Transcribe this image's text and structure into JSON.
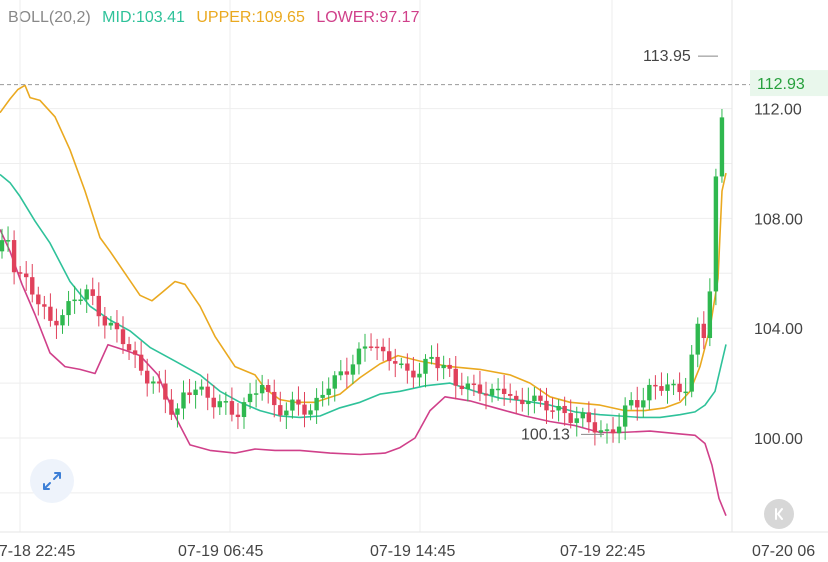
{
  "indicator": {
    "label": "BOLL(20,2)",
    "mid": "MID:103.41",
    "upper": "UPPER:109.65",
    "lower": "LOWER:97.17"
  },
  "colors": {
    "boll_label": "#888888",
    "mid": "#2fc29a",
    "upper": "#eaa920",
    "lower": "#d0408a",
    "up_candle": "#2fb84f",
    "down_candle": "#e0415b",
    "grid": "#eeeeee",
    "text": "#444444",
    "last_price_text": "#27a03d",
    "last_price_bg": "#e9f7ec"
  },
  "chart_data": {
    "type": "candlestick",
    "y_axis_labels": [
      "112.00",
      "108.00",
      "104.00",
      "100.00"
    ],
    "ylim": [
      97,
      115
    ],
    "x_tick_labels": [
      "07-18 22:45",
      "07-19 06:45",
      "07-19 14:45",
      "07-19 22:45",
      "07-20 06"
    ],
    "last_price": "112.93",
    "max_marker": "113.95",
    "min_marker": "100.13",
    "grid": true,
    "boll_upper": [
      [
        0,
        111.85
      ],
      [
        10,
        112.35
      ],
      [
        18,
        112.7
      ],
      [
        25,
        112.85
      ],
      [
        30,
        112.4
      ],
      [
        40,
        112.3
      ],
      [
        55,
        111.7
      ],
      [
        70,
        110.5
      ],
      [
        85,
        109.0
      ],
      [
        100,
        107.3
      ],
      [
        110,
        106.8
      ],
      [
        125,
        106.0
      ],
      [
        140,
        105.2
      ],
      [
        152,
        105.0
      ],
      [
        162,
        105.3
      ],
      [
        175,
        105.7
      ],
      [
        185,
        105.6
      ],
      [
        200,
        104.8
      ],
      [
        215,
        103.7
      ],
      [
        235,
        102.6
      ],
      [
        255,
        102.3
      ],
      [
        265,
        101.8
      ],
      [
        280,
        101.4
      ],
      [
        295,
        101.3
      ],
      [
        315,
        101.3
      ],
      [
        340,
        101.6
      ],
      [
        360,
        102.2
      ],
      [
        380,
        102.7
      ],
      [
        398,
        103.0
      ],
      [
        420,
        102.8
      ],
      [
        450,
        102.6
      ],
      [
        480,
        102.5
      ],
      [
        510,
        102.3
      ],
      [
        530,
        102.0
      ],
      [
        550,
        101.5
      ],
      [
        570,
        101.3
      ],
      [
        600,
        101.2
      ],
      [
        625,
        101.0
      ],
      [
        645,
        101.0
      ],
      [
        665,
        101.1
      ],
      [
        680,
        101.3
      ],
      [
        690,
        101.7
      ],
      [
        700,
        102.6
      ],
      [
        710,
        104.0
      ],
      [
        718,
        105.8
      ],
      [
        722,
        109.0
      ],
      [
        726,
        109.65
      ]
    ],
    "boll_mid": [
      [
        0,
        109.6
      ],
      [
        10,
        109.3
      ],
      [
        20,
        108.8
      ],
      [
        35,
        107.9
      ],
      [
        50,
        107.1
      ],
      [
        70,
        105.7
      ],
      [
        90,
        104.8
      ],
      [
        110,
        104.3
      ],
      [
        130,
        103.9
      ],
      [
        150,
        103.3
      ],
      [
        175,
        102.8
      ],
      [
        200,
        102.3
      ],
      [
        220,
        101.7
      ],
      [
        240,
        101.3
      ],
      [
        260,
        101.0
      ],
      [
        280,
        100.8
      ],
      [
        300,
        100.75
      ],
      [
        320,
        100.8
      ],
      [
        340,
        101.1
      ],
      [
        360,
        101.3
      ],
      [
        380,
        101.6
      ],
      [
        400,
        101.7
      ],
      [
        425,
        101.9
      ],
      [
        450,
        102.0
      ],
      [
        475,
        101.7
      ],
      [
        500,
        101.45
      ],
      [
        525,
        101.35
      ],
      [
        550,
        101.2
      ],
      [
        575,
        100.95
      ],
      [
        600,
        100.85
      ],
      [
        620,
        100.8
      ],
      [
        640,
        100.75
      ],
      [
        660,
        100.75
      ],
      [
        680,
        100.85
      ],
      [
        695,
        100.95
      ],
      [
        705,
        101.2
      ],
      [
        715,
        101.7
      ],
      [
        726,
        103.41
      ]
    ],
    "boll_lower": [
      [
        0,
        107.6
      ],
      [
        10,
        106.8
      ],
      [
        22,
        105.6
      ],
      [
        35,
        104.5
      ],
      [
        50,
        103.1
      ],
      [
        65,
        102.6
      ],
      [
        80,
        102.5
      ],
      [
        95,
        102.35
      ],
      [
        108,
        103.4
      ],
      [
        125,
        103.2
      ],
      [
        140,
        103.0
      ],
      [
        158,
        102.3
      ],
      [
        175,
        100.8
      ],
      [
        190,
        99.75
      ],
      [
        210,
        99.55
      ],
      [
        235,
        99.45
      ],
      [
        255,
        99.6
      ],
      [
        275,
        99.55
      ],
      [
        300,
        99.55
      ],
      [
        330,
        99.45
      ],
      [
        360,
        99.4
      ],
      [
        385,
        99.45
      ],
      [
        400,
        99.65
      ],
      [
        415,
        100.0
      ],
      [
        430,
        101.0
      ],
      [
        445,
        101.5
      ],
      [
        470,
        101.35
      ],
      [
        500,
        101.05
      ],
      [
        525,
        100.8
      ],
      [
        550,
        100.6
      ],
      [
        575,
        100.45
      ],
      [
        600,
        100.2
      ],
      [
        620,
        100.2
      ],
      [
        650,
        100.25
      ],
      [
        680,
        100.15
      ],
      [
        695,
        100.1
      ],
      [
        705,
        99.8
      ],
      [
        712,
        99.0
      ],
      [
        719,
        97.8
      ],
      [
        726,
        97.17
      ]
    ]
  },
  "controls": {
    "expand_icon": "expand-arrows-icon",
    "collapse_icon": "collapse-panel-icon"
  }
}
